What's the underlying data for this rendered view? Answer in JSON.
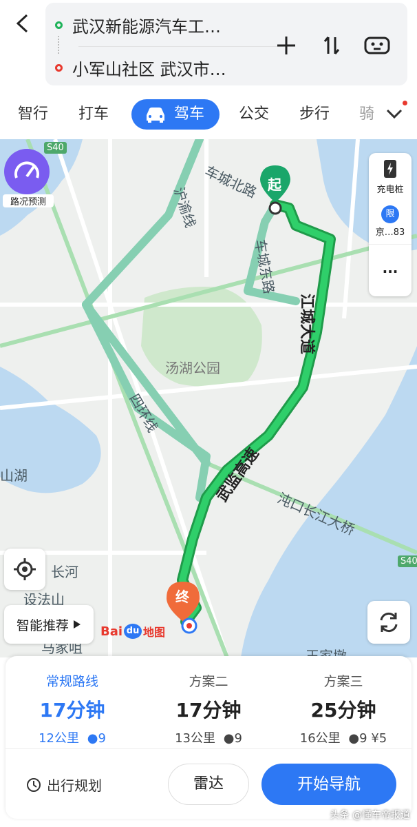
{
  "header": {
    "origin": "武汉新能源汽车工…",
    "destination": "小军山社区 武汉市…"
  },
  "tabs": [
    {
      "label": "智行"
    },
    {
      "label": "打车"
    },
    {
      "label": "驾车"
    },
    {
      "label": "公交"
    },
    {
      "label": "步行"
    },
    {
      "label": "骑"
    }
  ],
  "map": {
    "road_badge_s40_top": "S40",
    "road_badge_s40_right": "S40",
    "traffic_forecast": "路况预测",
    "charging": "充电桩",
    "restriction_icon": "限",
    "restriction": "京…83",
    "more": "···",
    "start_marker": "起",
    "end_marker": "终",
    "smart_recommend": "智能推荐",
    "logo_bai": "Bai",
    "logo_du": "du",
    "logo_map": "地图",
    "labels": {
      "chengbei": "车城北路",
      "huyi": "沪渝线",
      "chengdong": "车城东路",
      "jiangcheng": "江城大道",
      "tanghu": "汤湖公园",
      "sihuan": "四环线",
      "wujian": "武监高速",
      "junkou": "沌口长江大桥",
      "shanhu": "山湖",
      "changhe": "长河",
      "shefa": "设法山",
      "majia": "马家咀",
      "wangjia": "王家墩"
    }
  },
  "routes": [
    {
      "name": "常规路线",
      "time": "17分钟",
      "distance": "12公里",
      "lights": "9",
      "toll": ""
    },
    {
      "name": "方案二",
      "time": "17分钟",
      "distance": "13公里",
      "lights": "9",
      "toll": ""
    },
    {
      "name": "方案三",
      "time": "25分钟",
      "distance": "16公里",
      "lights": "9",
      "toll": "¥5"
    }
  ],
  "actions": {
    "plan": "出行规划",
    "radar": "雷达",
    "navigate": "开始导航"
  },
  "watermark": "头条 @懂车帝报道",
  "colors": {
    "accent": "#2d78f4",
    "route_main": "#1fb35a",
    "route_alt": "#86cfb2",
    "start_marker": "#1aa66a",
    "end_marker": "#f06b3a"
  }
}
